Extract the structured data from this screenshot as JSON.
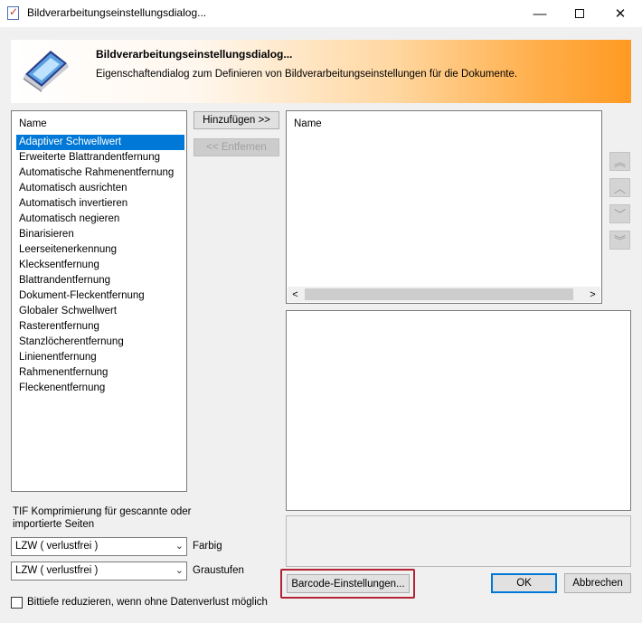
{
  "window": {
    "title": "Bildverarbeitungseinstellungsdialog...",
    "controls": {
      "minimize": "—",
      "maximize": "",
      "close": "✕"
    }
  },
  "banner": {
    "title": "Bildverarbeitungseinstellungsdialog...",
    "subtitle": "Eigenschaftendialog zum Definieren von Bildverarbeitungseinstellungen für die Dokumente.",
    "icon": "scanner-icon"
  },
  "available_list": {
    "header": "Name",
    "items": [
      "Adaptiver Schwellwert",
      "Erweiterte Blattrandentfernung",
      "Automatische Rahmenentfernung",
      "Automatisch ausrichten",
      "Automatisch invertieren",
      "Automatisch negieren",
      "Binarisieren",
      "Leerseitenerkennung",
      "Klecksentfernung",
      "Blattrandentfernung",
      "Dokument-Fleckentfernung",
      "Globaler Schwellwert",
      "Rasterentfernung",
      "Stanzlöcherentfernung",
      "Linienentfernung",
      "Rahmenentfernung",
      "Fleckenentfernung"
    ],
    "selected_index": 0
  },
  "buttons": {
    "add": "Hinzufügen >>",
    "remove": "<< Entfernen",
    "barcode": "Barcode-Einstellungen...",
    "ok": "OK",
    "cancel": "Abbrechen"
  },
  "selected_list": {
    "header": "Name",
    "scroll_left": "<",
    "scroll_right": ">"
  },
  "order_arrows": {
    "top": "︽",
    "up": "︿",
    "down": "﹀",
    "bottom": "︾"
  },
  "compression": {
    "label": "TIF Komprimierung für gescannte oder importierte Seiten",
    "color_value": "LZW ( verlustfrei )",
    "color_label": "Farbig",
    "gray_value": "LZW ( verlustfrei )",
    "gray_label": "Graustufen",
    "chevron": "⌄"
  },
  "bitdepth": {
    "label": "Bittiefe reduzieren, wenn ohne Datenverlust möglich",
    "checked": false
  },
  "colors": {
    "selection": "#0078d7",
    "highlight": "#b22234",
    "banner_orange": "#ff9a22"
  }
}
